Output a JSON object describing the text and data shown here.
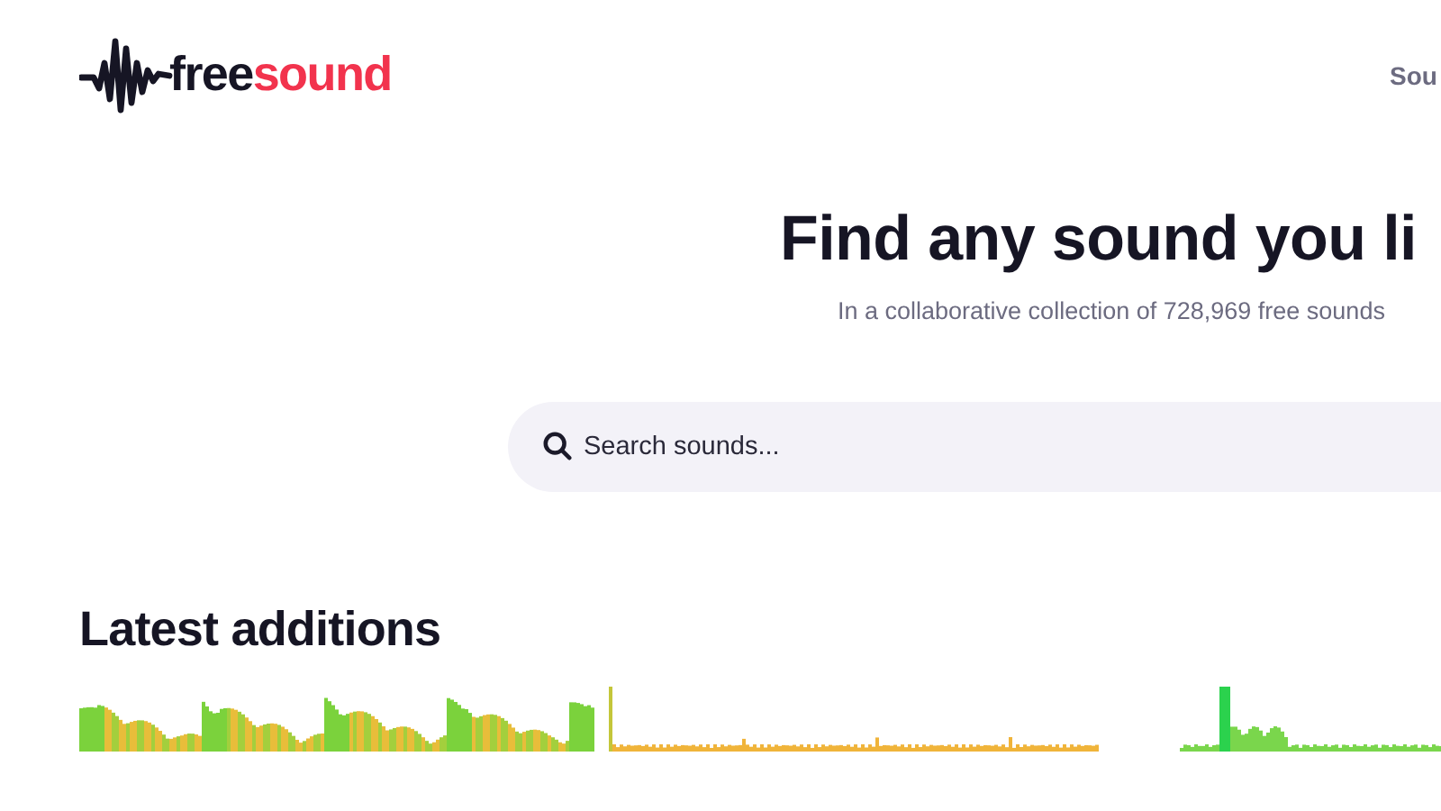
{
  "logo": {
    "dark": "free",
    "accent": "sound"
  },
  "nav": {
    "label": "Sou"
  },
  "hero": {
    "title": "Find any sound you li",
    "subtitle": "In a collaborative collection of 728,969 free sounds"
  },
  "search": {
    "placeholder": "Search sounds..."
  },
  "latest": {
    "heading": "Latest additions",
    "sounds": [
      {
        "kind": "waveform"
      },
      {
        "kind": "waveform"
      },
      {
        "kind": "waveform"
      }
    ]
  }
}
